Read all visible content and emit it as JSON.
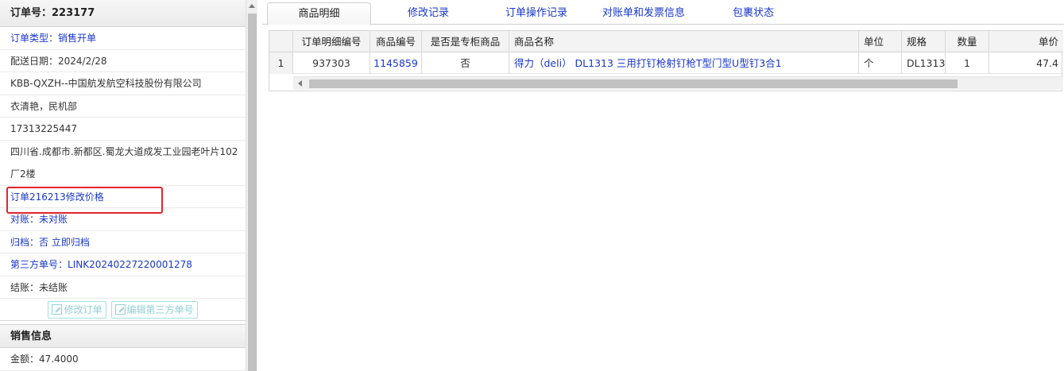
{
  "left_panel": {
    "header": "订单号：223177",
    "order_type": "订单类型：销售开单",
    "delivery_date": "配送日期：2024/2/28",
    "company": "KBB-QXZH--中国航发航空科技股份有限公司",
    "contact": "衣清艳，民机部",
    "phone": "17313225447",
    "address": "四川省.成都市.新都区.蜀龙大道成发工业园老叶片102厂2楼",
    "note": "订单216213修改价格",
    "reconcile": {
      "label": "对账：",
      "value": "未对账"
    },
    "archive": {
      "label": "归档：",
      "value": "否",
      "link": "立即归档"
    },
    "third_party": {
      "label": "第三方单号：",
      "value": "LINK20240227220001278"
    },
    "settlement": "结账：未结账",
    "buttons": {
      "edit_order": "修改订单",
      "edit_third_party": "编辑第三方单号"
    },
    "sales_header": "销售信息",
    "amount": "金额：47.4000"
  },
  "tabs": [
    {
      "label": "商品明细",
      "active": true
    },
    {
      "label": "修改记录",
      "active": false
    },
    {
      "label": "订单操作记录",
      "active": false
    },
    {
      "label": "对账单和发票信息",
      "active": false
    },
    {
      "label": "包裹状态",
      "active": false
    }
  ],
  "table": {
    "headers": [
      "",
      "订单明细编号",
      "商品编号",
      "是否是专柜商品",
      "商品名称",
      "单位",
      "规格",
      "数量",
      "单价"
    ],
    "rows": [
      [
        "1",
        "937303",
        "1145859",
        "否",
        "得力（deli） DL1313 三用打钉枪射钉枪T型门型U型钉3合1",
        "个",
        "DL1313",
        "1",
        "47.4"
      ]
    ]
  },
  "icons": [
    "edit-icon",
    "scroll-up-arrow",
    "scroll-left-arrow"
  ]
}
